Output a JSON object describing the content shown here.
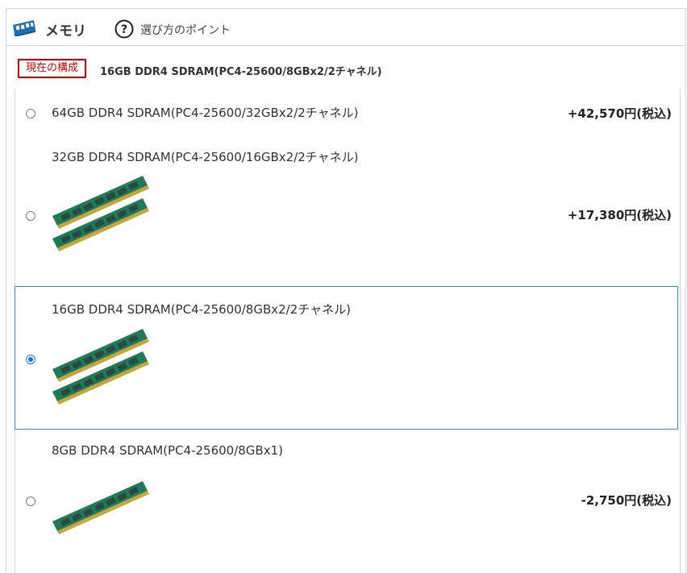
{
  "header": {
    "icon": "memory-icon",
    "title": "メモリ",
    "help_icon": "question-circle-icon",
    "help_text": "選び方のポイント"
  },
  "current": {
    "badge": "現在の構成",
    "value": "16GB DDR4 SDRAM(PC4-25600/8GBx2/2チャネル)"
  },
  "options": [
    {
      "label": "64GB DDR4 SDRAM(PC4-25600/32GBx2/2チャネル)",
      "price": "+42,570円(税込)",
      "selected": false,
      "image": "none"
    },
    {
      "label": "32GB DDR4 SDRAM(PC4-25600/16GBx2/2チャネル)",
      "price": "+17,380円(税込)",
      "selected": false,
      "image": "ram-dual-icon"
    },
    {
      "label": "16GB DDR4 SDRAM(PC4-25600/8GBx2/2チャネル)",
      "price": "",
      "selected": true,
      "image": "ram-dual-icon"
    },
    {
      "label": "8GB DDR4 SDRAM(PC4-25600/8GBx1)",
      "price": "-2,750円(税込)",
      "selected": false,
      "image": "ram-single-icon"
    }
  ],
  "colors": {
    "accent": "#1a73e8",
    "selected_border": "#2f8fd8",
    "badge_red": "#d40000",
    "ram_pcb": "#1f7a5a",
    "ram_chip": "#2b4a3f",
    "ram_contacts": "#c9a43a"
  }
}
